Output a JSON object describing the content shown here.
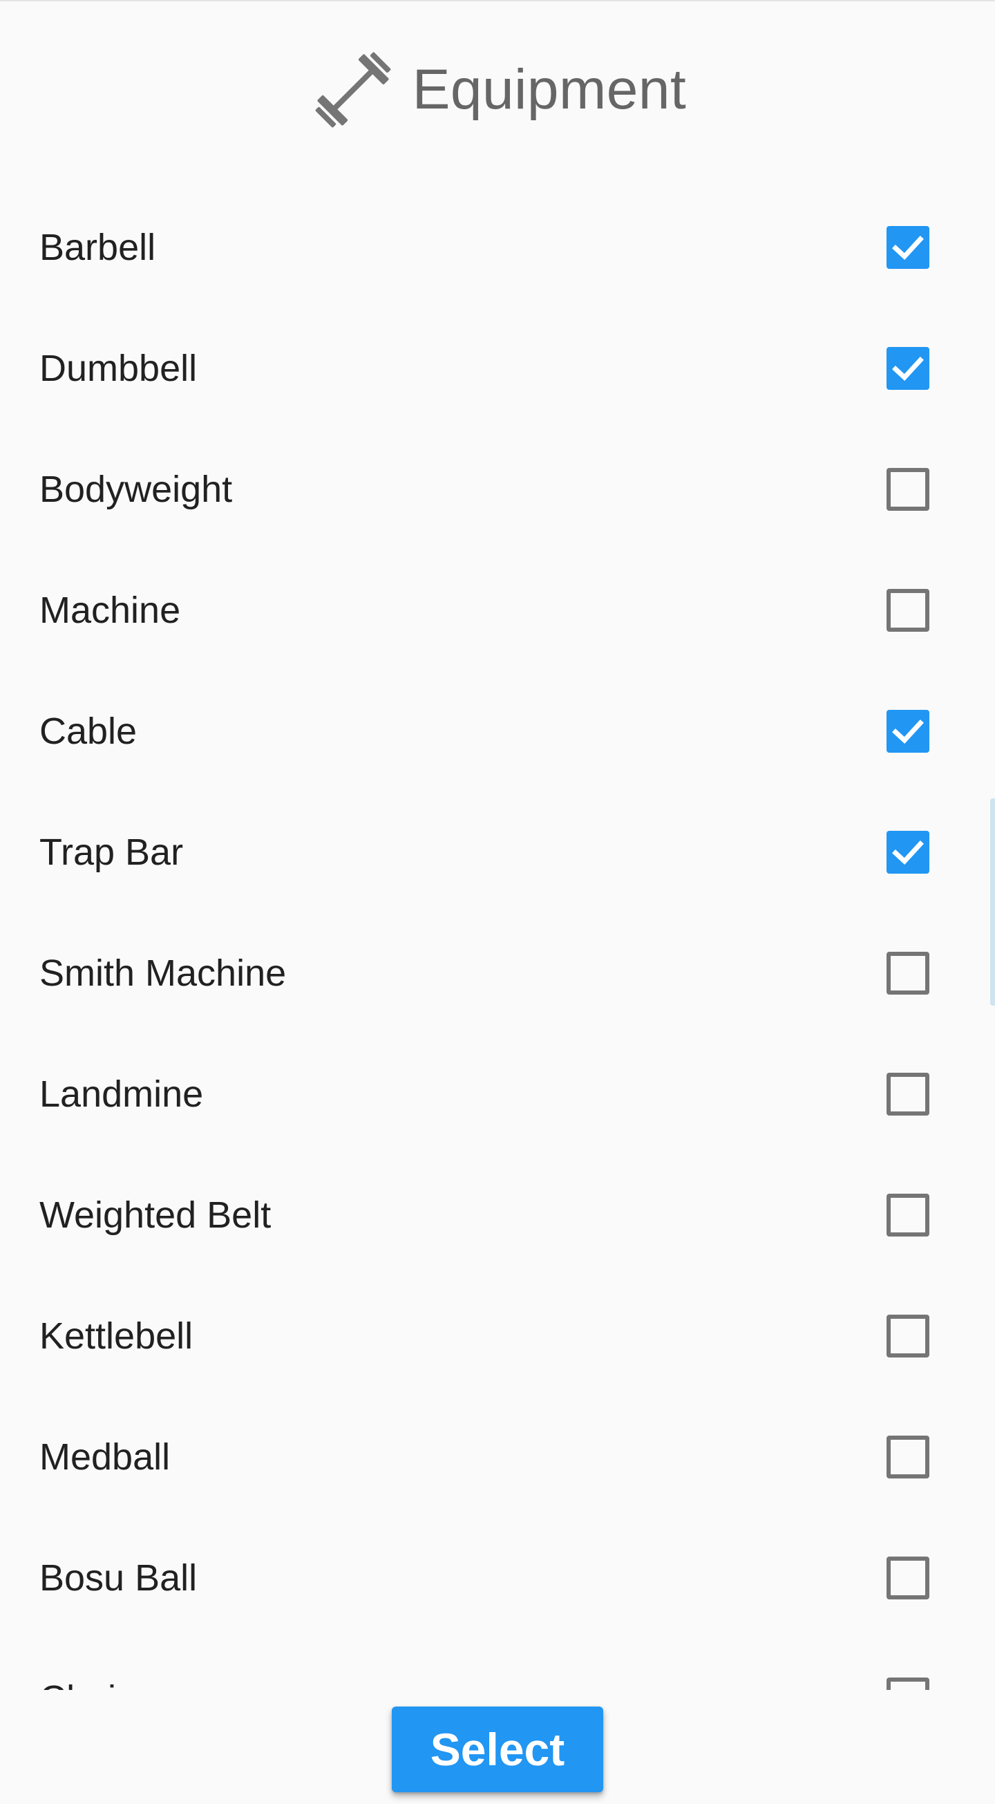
{
  "header": {
    "icon": "dumbbell-icon",
    "title": "Equipment"
  },
  "colors": {
    "accent": "#2196F3",
    "unchecked_border": "#757575",
    "label_text": "#212121",
    "title_text": "#666666",
    "background": "#FAFAFA"
  },
  "equipment": [
    {
      "label": "Barbell",
      "checked": true
    },
    {
      "label": "Dumbbell",
      "checked": true
    },
    {
      "label": "Bodyweight",
      "checked": false
    },
    {
      "label": "Machine",
      "checked": false
    },
    {
      "label": "Cable",
      "checked": true
    },
    {
      "label": "Trap Bar",
      "checked": true
    },
    {
      "label": "Smith Machine",
      "checked": false
    },
    {
      "label": "Landmine",
      "checked": false
    },
    {
      "label": "Weighted Belt",
      "checked": false
    },
    {
      "label": "Kettlebell",
      "checked": false
    },
    {
      "label": "Medball",
      "checked": false
    },
    {
      "label": "Bosu Ball",
      "checked": false
    },
    {
      "label": "Chains",
      "checked": false
    }
  ],
  "actions": {
    "select_label": "Select"
  }
}
